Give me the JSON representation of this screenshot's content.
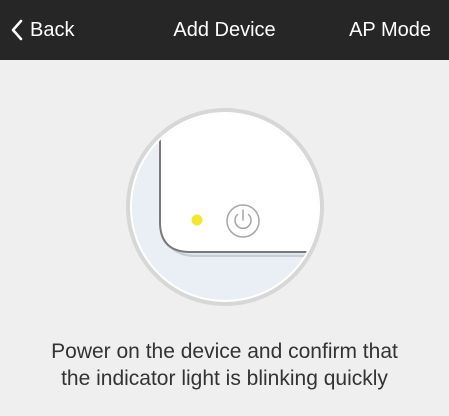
{
  "nav": {
    "back_label": "Back",
    "title": "Add Device",
    "right_action": "AP Mode"
  },
  "illustration": {
    "power_icon": "power-icon",
    "indicator_color": "#f4e632"
  },
  "instruction": {
    "line1": "Power on the device and confirm that",
    "line2": "the indicator light is blinking quickly"
  },
  "colors": {
    "nav_background": "#262626",
    "page_background": "#efefef",
    "text": "#333333"
  }
}
